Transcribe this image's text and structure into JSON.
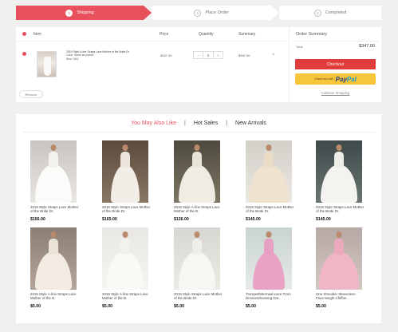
{
  "steps": [
    {
      "num": "1",
      "label": "Shipping"
    },
    {
      "num": "2",
      "label": "Place Order"
    },
    {
      "num": "3",
      "label": "Completed"
    }
  ],
  "cart": {
    "headers": {
      "item": "Item",
      "price": "Price",
      "quantity": "Quantity",
      "summary": "Summary"
    },
    "item": {
      "title": "2015 Style A-line Straps Lace Mother of the Bride Dr.",
      "meta1": "Color: Same as picture",
      "meta2": "Size: US4",
      "price": "$347.00",
      "quantity": "1",
      "summary": "$347.00",
      "remove_glyph": "×"
    },
    "stepper": {
      "minus": "−",
      "plus": "+"
    },
    "remove_label": "Remove"
  },
  "summary": {
    "title": "Order Summary",
    "total_label": "Total",
    "total_value": "$347.00",
    "checkout_label": "Checkout",
    "paypal_prefix": "Check out with",
    "paypal_brand_a": "Pay",
    "paypal_brand_b": "Pal",
    "continue_label": "Continue Shopping"
  },
  "recs": {
    "tabs": [
      "You May Also Like",
      "Hot Sales",
      "New Arrivals"
    ],
    "separator": "|",
    "products": [
      {
        "name": "2015 Style Straps Lace Mother of the Bride Dr.",
        "price": "$156.00"
      },
      {
        "name": "2015 Style Straps Lace Mother of the Bride Dr.",
        "price": "$165.00"
      },
      {
        "name": "2015 Style A-line Straps Lace Mother of the B.",
        "price": "$126.00"
      },
      {
        "name": "2015 Style Straps Lace Mother of the Bride Dr.",
        "price": "$145.00"
      },
      {
        "name": "2015 Style Straps Lace Mother of the Bride Dr.",
        "price": "$145.00"
      },
      {
        "name": "2015 Style A-line Straps Lace Mother of the B.",
        "price": "$5.00"
      },
      {
        "name": "2015 Style A-line Straps Lace Mother of the B.",
        "price": "$5.00"
      },
      {
        "name": "2015 Style Straps Lace Mother of the Bride Dr.",
        "price": "$5.00"
      },
      {
        "name": "Trumpet/Mermaid Lace From Dresses/Evening Dre.",
        "price": "$5.00"
      },
      {
        "name": "One Shoulder Sleeveless Floor-length Chiffon .",
        "price": "$5.00"
      }
    ]
  },
  "colors": {
    "accent": "#e8505b",
    "checkout": "#e03c3c",
    "paypal": "#f7c53a"
  }
}
